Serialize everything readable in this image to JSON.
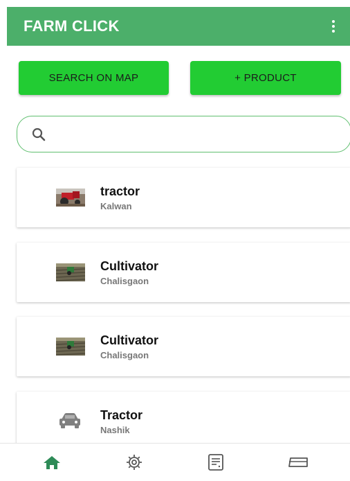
{
  "app": {
    "title": "FARM CLICK"
  },
  "colors": {
    "primary": "#4caf6a",
    "button": "#22cc33",
    "active_nav": "#2e8b57"
  },
  "actions": {
    "search_map_label": "SEARCH ON MAP",
    "add_product_label": "+ PRODUCT"
  },
  "search": {
    "value": "",
    "placeholder": ""
  },
  "items": [
    {
      "title": "tractor",
      "location": "Kalwan",
      "icon": "tractor-photo"
    },
    {
      "title": "Cultivator",
      "location": "Chalisgaon",
      "icon": "field-photo"
    },
    {
      "title": "Cultivator",
      "location": "Chalisgaon",
      "icon": "field-photo"
    },
    {
      "title": "Tractor",
      "location": "Nashik",
      "icon": "car-icon"
    }
  ],
  "bottom_nav": [
    {
      "icon": "home-icon",
      "active": true
    },
    {
      "icon": "gear-icon",
      "active": false
    },
    {
      "icon": "notes-icon",
      "active": false
    },
    {
      "icon": "ticket-icon",
      "active": false
    }
  ]
}
